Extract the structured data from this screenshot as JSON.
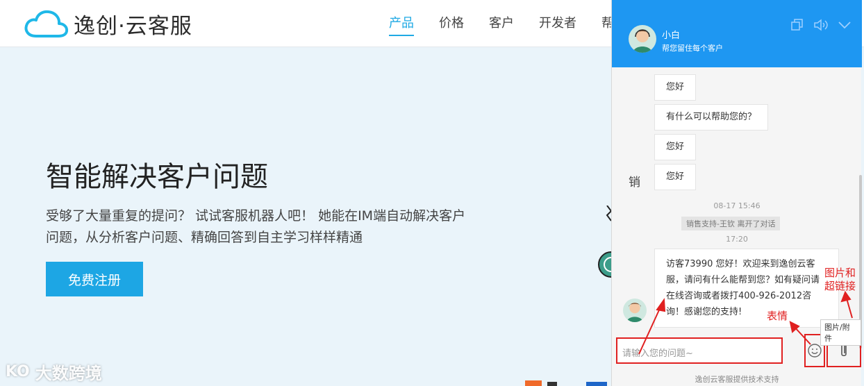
{
  "site": {
    "logo_text": "逸创·云客服",
    "nav": [
      "产品",
      "价格",
      "客户",
      "开发者",
      "帮"
    ],
    "active_nav": "产品",
    "brand_color": "#1fa9e4"
  },
  "hero": {
    "title": "智能解决客户问题",
    "description": "受够了大量重复的提问？ 试试客服机器人吧！ 她能在IM端自动解决客户问题，从分析客户问题、精确回答到自主学习样样精通",
    "cta": "免费注册"
  },
  "watermark": {
    "mark": "KO",
    "text": "大数跨境"
  },
  "chat": {
    "header_color": "#1e97f2",
    "agent_name": "小白",
    "agent_tagline": "帮您留住每个客户",
    "header_icons": [
      "window-icon",
      "speaker-icon",
      "chevron-down-icon"
    ],
    "side_label": "销",
    "messages": [
      "您好",
      "有什么可以帮助您的？",
      "您好",
      "您好"
    ],
    "time1": "08-17 15:46",
    "system_notice": "销售支持-王钦 离开了对话",
    "time2": "17:20",
    "welcome": "访客73990 您好！欢迎来到逸创云客服，请问有什么能帮到您？如有疑问请在线咨询或者拨打400-926-2012咨询！感谢您的支持!",
    "input_placeholder": "请输入您的问题~",
    "attach_tooltip": "图片/附件",
    "powered_by": "逸创云客服提供技术支持"
  },
  "annotations": {
    "emoji": "表情",
    "attach": "图片和超链接",
    "color": "#e02020"
  }
}
